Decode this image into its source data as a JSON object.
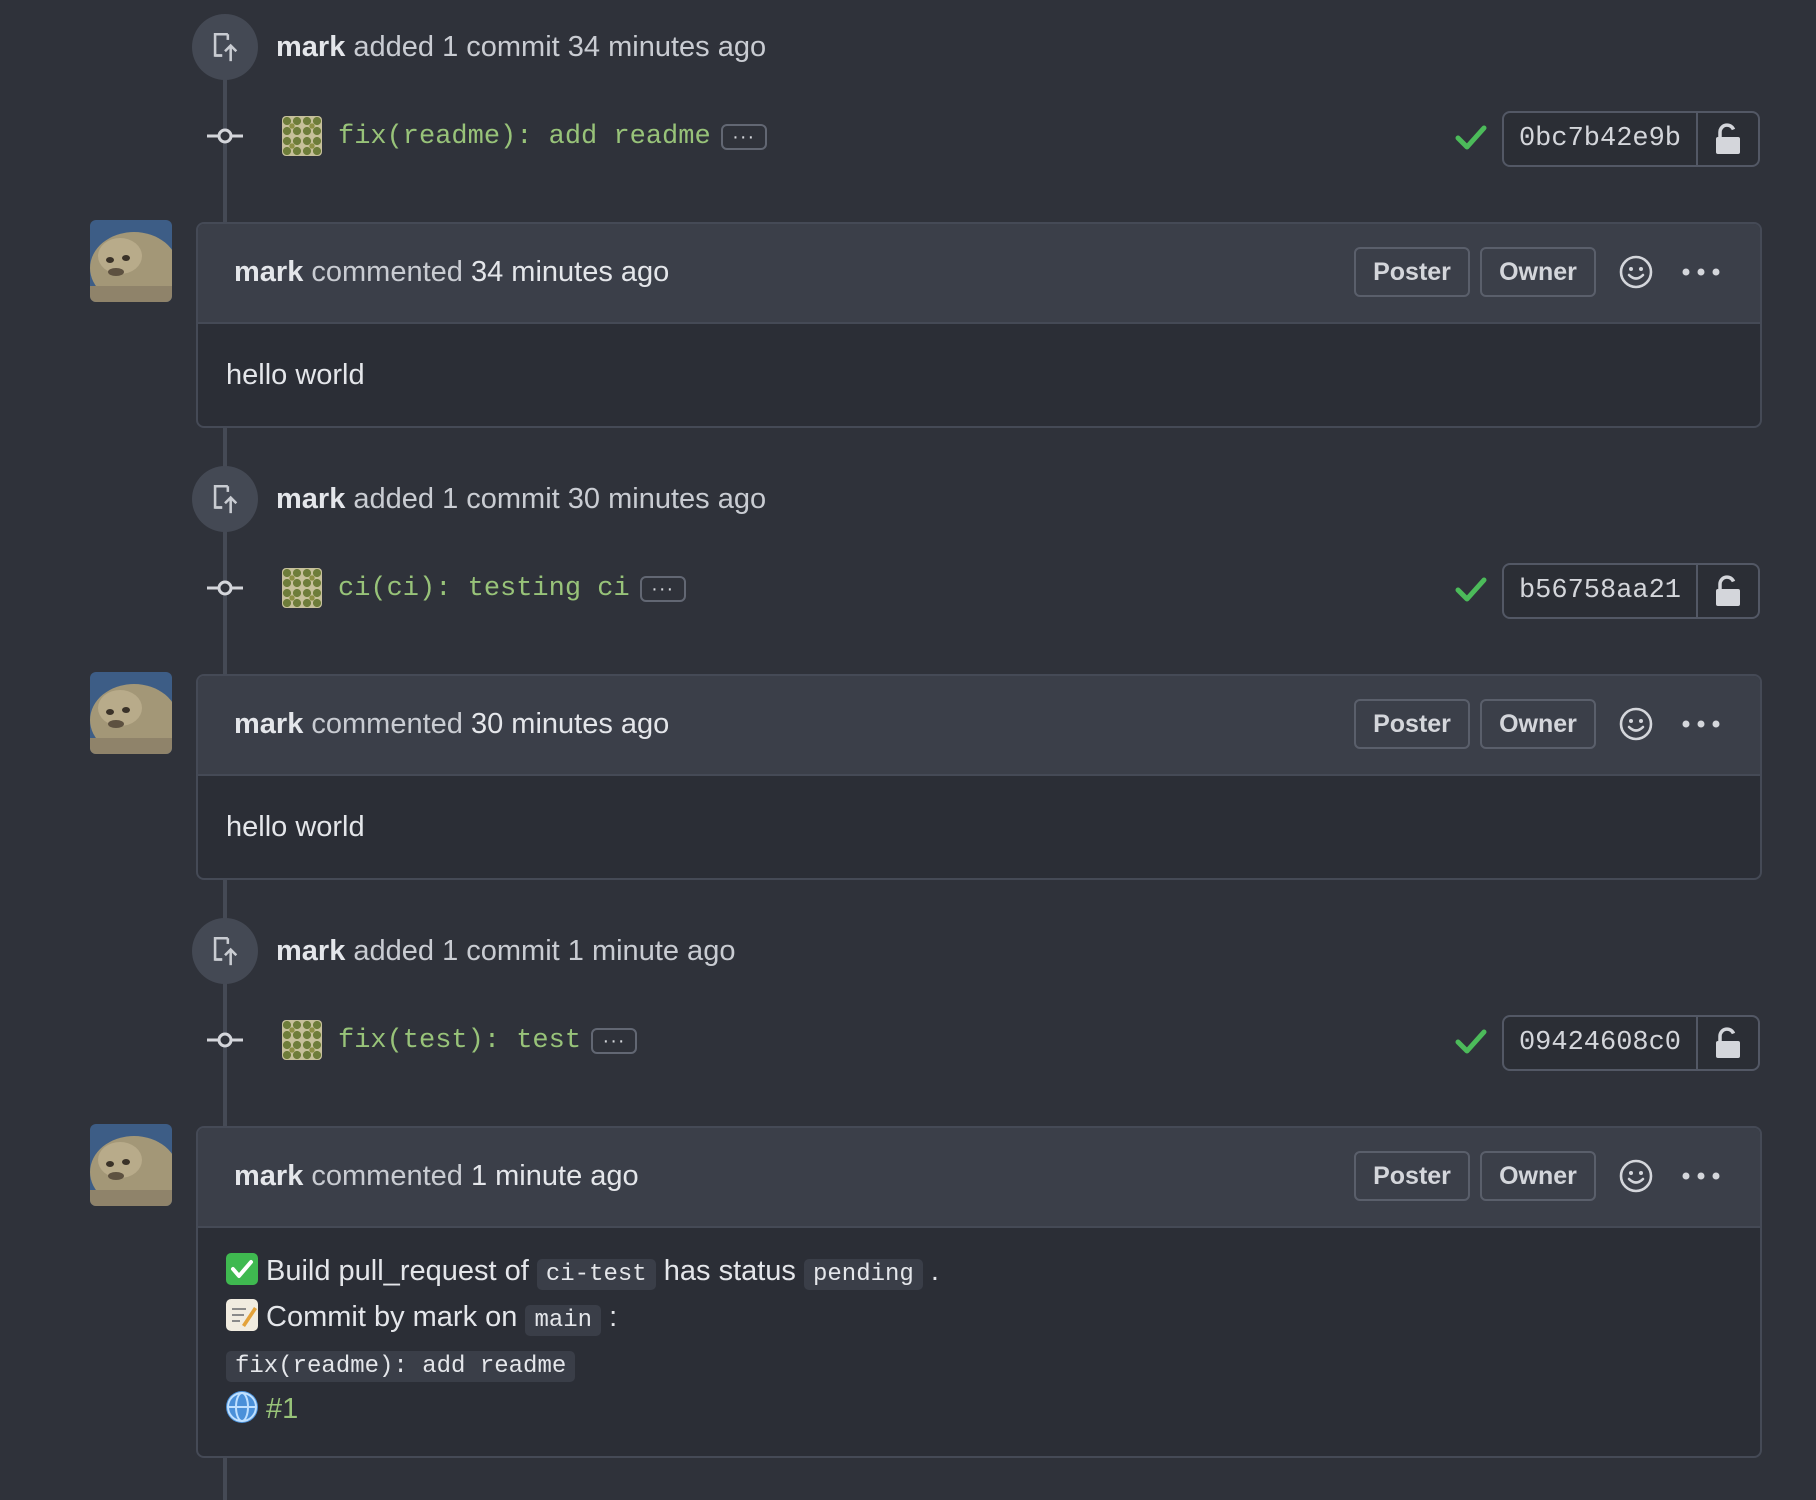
{
  "events": [
    {
      "author": "mark",
      "action": "added 1 commit 34 minutes ago",
      "commit": {
        "message": "fix(readme): add readme",
        "sha": "0bc7b42e9b",
        "ellipsis": "···"
      }
    },
    {
      "author": "mark",
      "action": "added 1 commit 30 minutes ago",
      "commit": {
        "message": "ci(ci): testing ci",
        "sha": "b56758aa21",
        "ellipsis": "···"
      }
    },
    {
      "author": "mark",
      "action": "added 1 commit 1 minute ago",
      "commit": {
        "message": "fix(test): test",
        "sha": "09424608c0",
        "ellipsis": "···"
      }
    }
  ],
  "comments": [
    {
      "author": "mark",
      "verb": "commented",
      "time": "34 minutes ago",
      "poster_label": "Poster",
      "owner_label": "Owner",
      "body": "hello world"
    },
    {
      "author": "mark",
      "verb": "commented",
      "time": "30 minutes ago",
      "poster_label": "Poster",
      "owner_label": "Owner",
      "body": "hello world"
    },
    {
      "author": "mark",
      "verb": "commented",
      "time": "1 minute ago",
      "poster_label": "Poster",
      "owner_label": "Owner",
      "build": {
        "line1_prefix": "Build pull_request of",
        "repo": "ci-test",
        "line1_mid": "has status",
        "status": "pending",
        "line1_end": ".",
        "line2_prefix": "Commit by mark on",
        "branch": "main",
        "line2_end": ":",
        "commit_message": "fix(readme): add readme",
        "link": "#1"
      }
    }
  ],
  "icons": {
    "event_badge": "push-icon",
    "commit_node": "git-commit-icon",
    "status": "check-icon",
    "lock": "unlock-icon",
    "react": "smiley-icon",
    "more": "kebab-horizontal-icon"
  },
  "colors": {
    "background": "#2f323a",
    "accent_green": "#98c379",
    "check_green": "#4cbb5a"
  }
}
